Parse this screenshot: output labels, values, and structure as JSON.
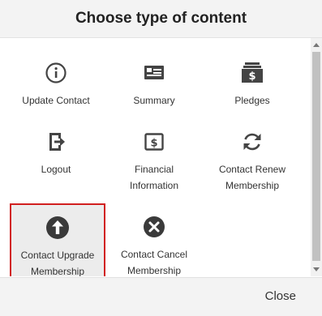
{
  "dialog": {
    "title": "Choose type of content",
    "close_label": "Close"
  },
  "tiles": [
    {
      "label": "Update Contact",
      "icon": "info-icon"
    },
    {
      "label": "Summary",
      "icon": "id-card-icon"
    },
    {
      "label": "Pledges",
      "icon": "money-stack-icon"
    },
    {
      "label": "Logout",
      "icon": "logout-icon"
    },
    {
      "label": "Financial\nInformation",
      "icon": "dollar-document-icon"
    },
    {
      "label": "Contact Renew\nMembership",
      "icon": "refresh-icon"
    },
    {
      "label": "Contact Upgrade\nMembership",
      "icon": "upgrade-arrow-icon",
      "selected": true
    },
    {
      "label": "Contact Cancel\nMembership",
      "icon": "cancel-x-icon"
    }
  ],
  "colors": {
    "selected_border": "#d11f1f",
    "selected_bg": "#ececec",
    "icon": "#444444"
  }
}
